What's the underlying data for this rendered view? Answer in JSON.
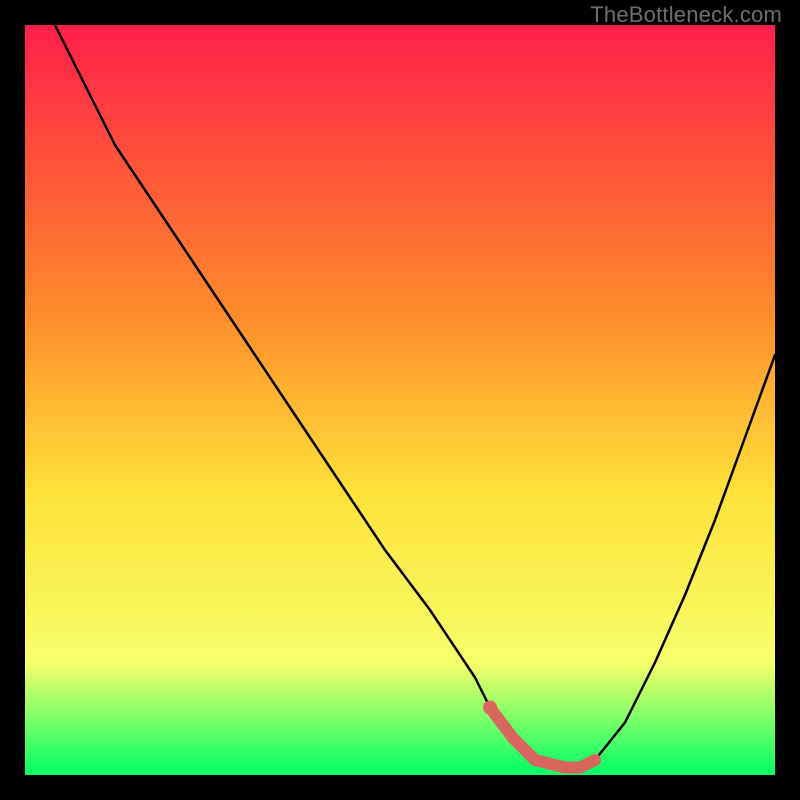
{
  "watermark": "TheBottleneck.com",
  "colors": {
    "frame": "#000000",
    "gradient_top": "#ff1f4a",
    "gradient_mid1": "#ff8a2a",
    "gradient_mid2": "#ffe13a",
    "gradient_mid3": "#f7ff6a",
    "gradient_bottom": "#00ff66",
    "curve": "#000000",
    "marker": "#d9655f"
  },
  "chart_data": {
    "type": "line",
    "title": "",
    "xlabel": "",
    "ylabel": "",
    "xlim": [
      0,
      100
    ],
    "ylim": [
      0,
      100
    ],
    "series": [
      {
        "name": "bottleneck-curve",
        "x": [
          4,
          8,
          12,
          18,
          24,
          30,
          36,
          42,
          48,
          54,
          60,
          62,
          65,
          68,
          72,
          74,
          76,
          80,
          84,
          88,
          92,
          96,
          100
        ],
        "values": [
          100,
          92,
          84,
          75,
          66,
          57,
          48,
          39,
          30,
          22,
          13,
          9,
          5,
          2,
          1,
          1,
          2,
          7,
          15,
          24,
          34,
          45,
          56
        ]
      }
    ],
    "marker_segment": {
      "name": "highlighted-range",
      "x": [
        62,
        65,
        68,
        72,
        74,
        76
      ],
      "values": [
        9,
        5,
        2,
        1,
        1,
        2
      ]
    }
  }
}
